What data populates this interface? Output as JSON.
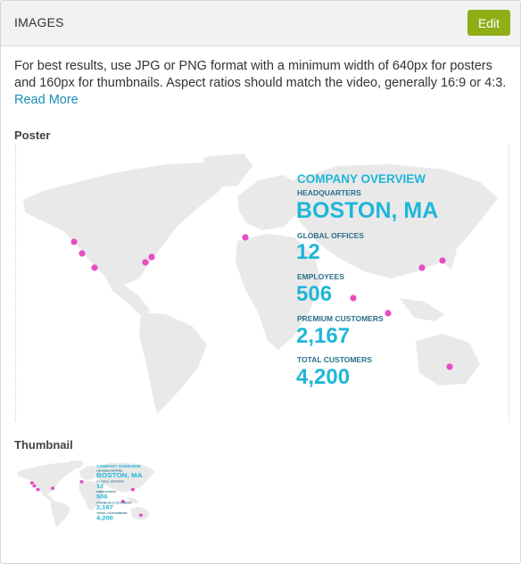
{
  "header": {
    "title": "IMAGES",
    "edit_label": "Edit"
  },
  "description": {
    "text": "For best results, use JPG or PNG format with a minimum width of 640px for posters and 160px for thumbnails. Aspect ratios should match the video, generally 16:9 or 4:3.",
    "link_label": "Read More"
  },
  "poster": {
    "label": "Poster",
    "overview": {
      "heading": "COMPANY OVERVIEW",
      "hq_label": "HEADQUARTERS",
      "hq_value": "BOSTON, MA",
      "offices_label": "GLOBAL OFFICES",
      "offices_value": "12",
      "employees_label": "EMPLOYEES",
      "employees_value": "506",
      "premium_label": "PREMIUM CUSTOMERS",
      "premium_value": "2,167",
      "total_label": "TOTAL CUSTOMERS",
      "total_value": "4,200"
    }
  },
  "thumbnail": {
    "label": "Thumbnail"
  },
  "colors": {
    "accent": "#8fad15",
    "link": "#1a8fb5",
    "cyan": "#1fb6d9",
    "label_blue": "#2b6f8c",
    "marker": "#e84bc2",
    "land": "#e9e9e9"
  }
}
